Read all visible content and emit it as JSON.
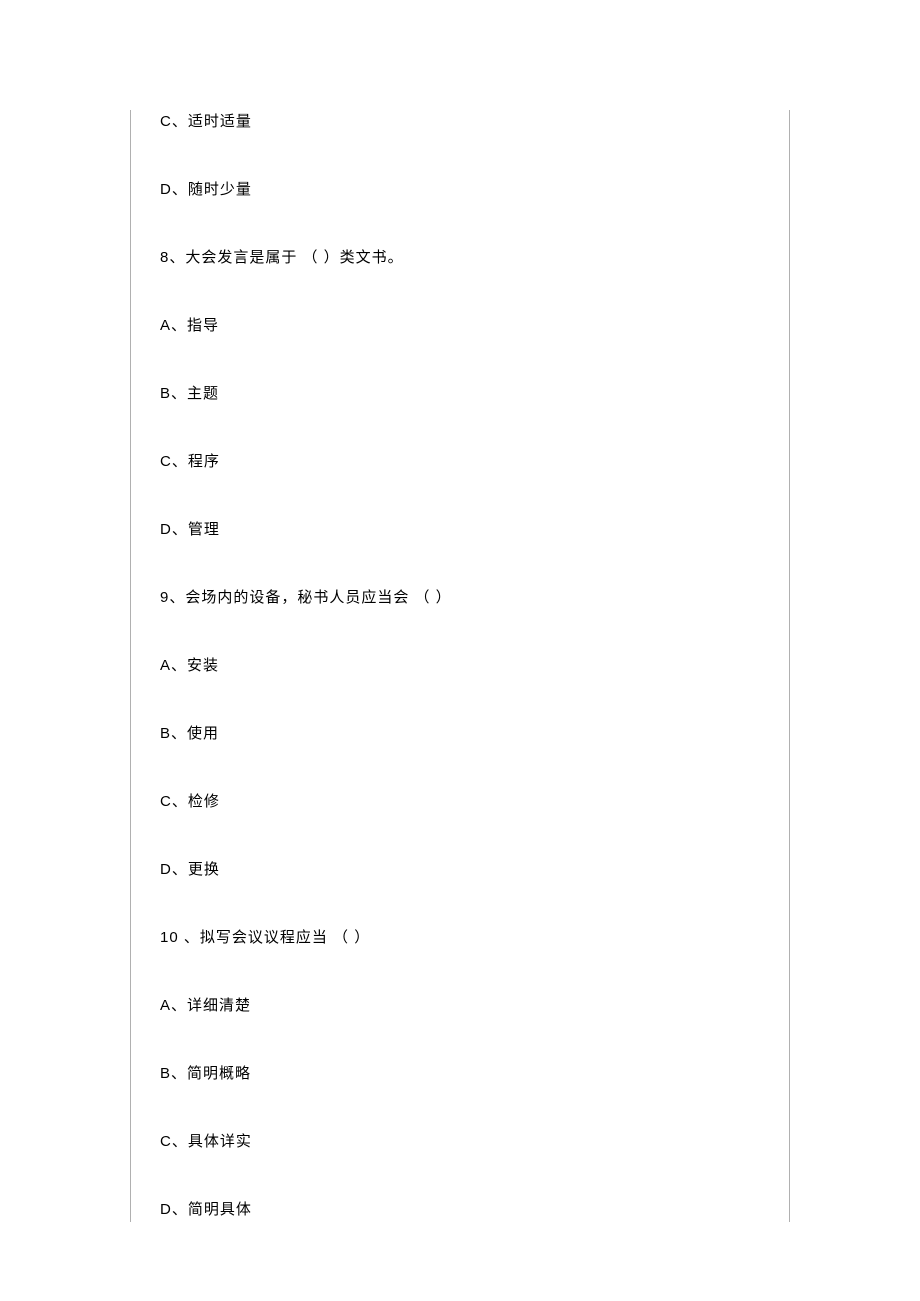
{
  "lines": {
    "q7c": "C、适时适量",
    "q7d": "D、随时少量",
    "q8": "8、大会发言是属于 （ ）类文书。",
    "q8a": "A、指导",
    "q8b": "B、主题",
    "q8c": "C、程序",
    "q8d": "D、管理",
    "q9": "9、会场内的设备，秘书人员应当会 （ ）",
    "q9a": "A、安装",
    "q9b": "B、使用",
    "q9c": "C、检修",
    "q9d": "D、更换",
    "q10": "10 、拟写会议议程应当 （ ）",
    "q10a": "A、详细清楚",
    "q10b": "B、简明概略",
    "q10c": "C、具体详实",
    "q10d": "D、简明具体"
  }
}
